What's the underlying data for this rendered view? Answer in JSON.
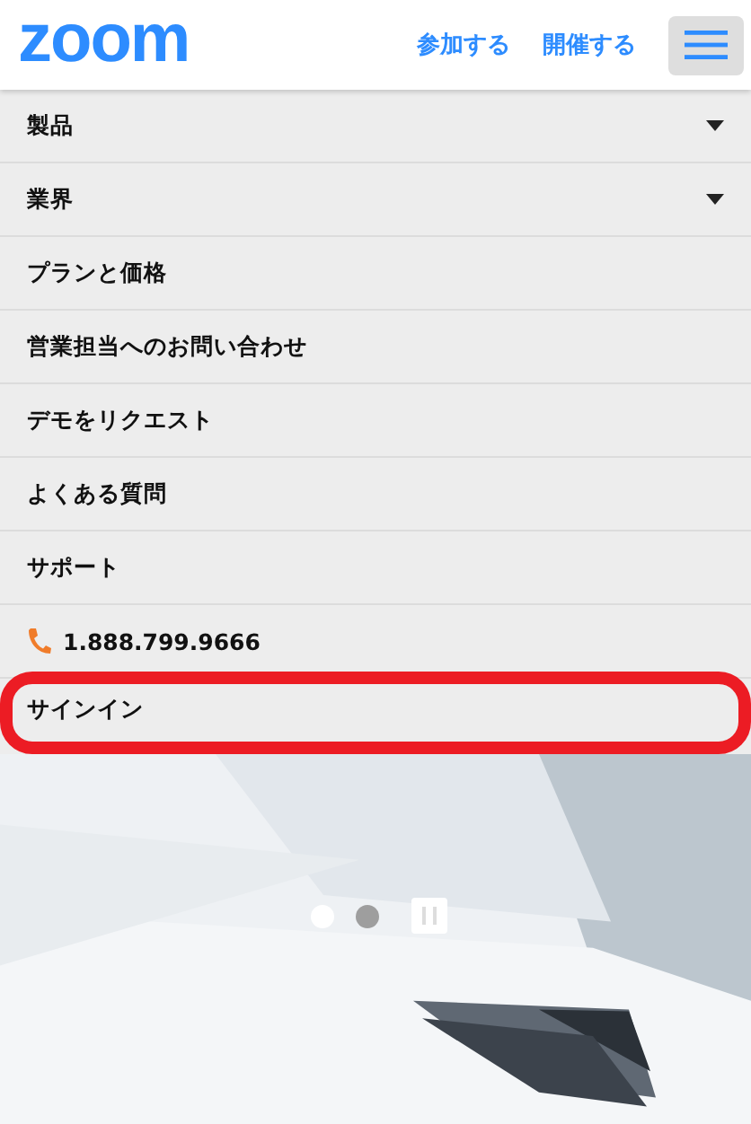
{
  "header": {
    "logo": "zoom",
    "links": [
      "参加する",
      "開催する"
    ],
    "menu_open": true
  },
  "menu": {
    "items": [
      {
        "label": "製品",
        "kind": "dropdown",
        "highlighted": false
      },
      {
        "label": "業界",
        "kind": "dropdown",
        "highlighted": false
      },
      {
        "label": "プランと価格",
        "kind": "link",
        "highlighted": false
      },
      {
        "label": "営業担当へのお問い合わせ",
        "kind": "link",
        "highlighted": false
      },
      {
        "label": "デモをリクエスト",
        "kind": "link",
        "highlighted": false
      },
      {
        "label": "よくある質問",
        "kind": "link",
        "highlighted": false
      },
      {
        "label": "サポート",
        "kind": "link",
        "highlighted": false
      },
      {
        "label": "1.888.799.9666",
        "kind": "phone",
        "highlighted": false
      },
      {
        "label": "サインイン",
        "kind": "link",
        "highlighted": true
      }
    ]
  },
  "hero": {
    "kind": "picture",
    "slides": [
      {
        "selected": true
      },
      {
        "selected": false
      }
    ]
  }
}
